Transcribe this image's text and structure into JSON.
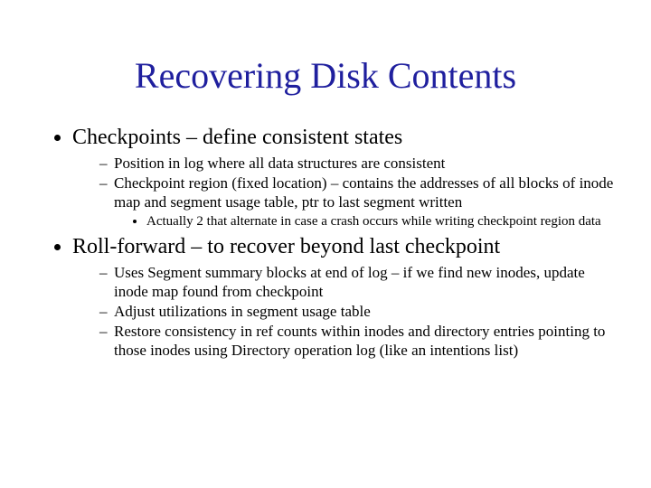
{
  "title": "Recovering Disk Contents",
  "bullets": {
    "b1": "Checkpoints – define consistent states",
    "b1_1": "Position in log where all data structures are consistent",
    "b1_2": "Checkpoint region (fixed location) – contains the addresses of all blocks of inode map and segment usage table, ptr to last segment written",
    "b1_2_1": "Actually 2 that alternate in case a crash occurs while writing checkpoint region data",
    "b2": "Roll-forward – to recover beyond last checkpoint",
    "b2_1": "Uses Segment summary blocks at end of log – if we find new inodes, update inode map found from checkpoint",
    "b2_2": "Adjust utilizations in segment usage table",
    "b2_3": "Restore consistency in ref counts within inodes and directory entries pointing to those inodes using Directory operation log (like an intentions list)"
  }
}
